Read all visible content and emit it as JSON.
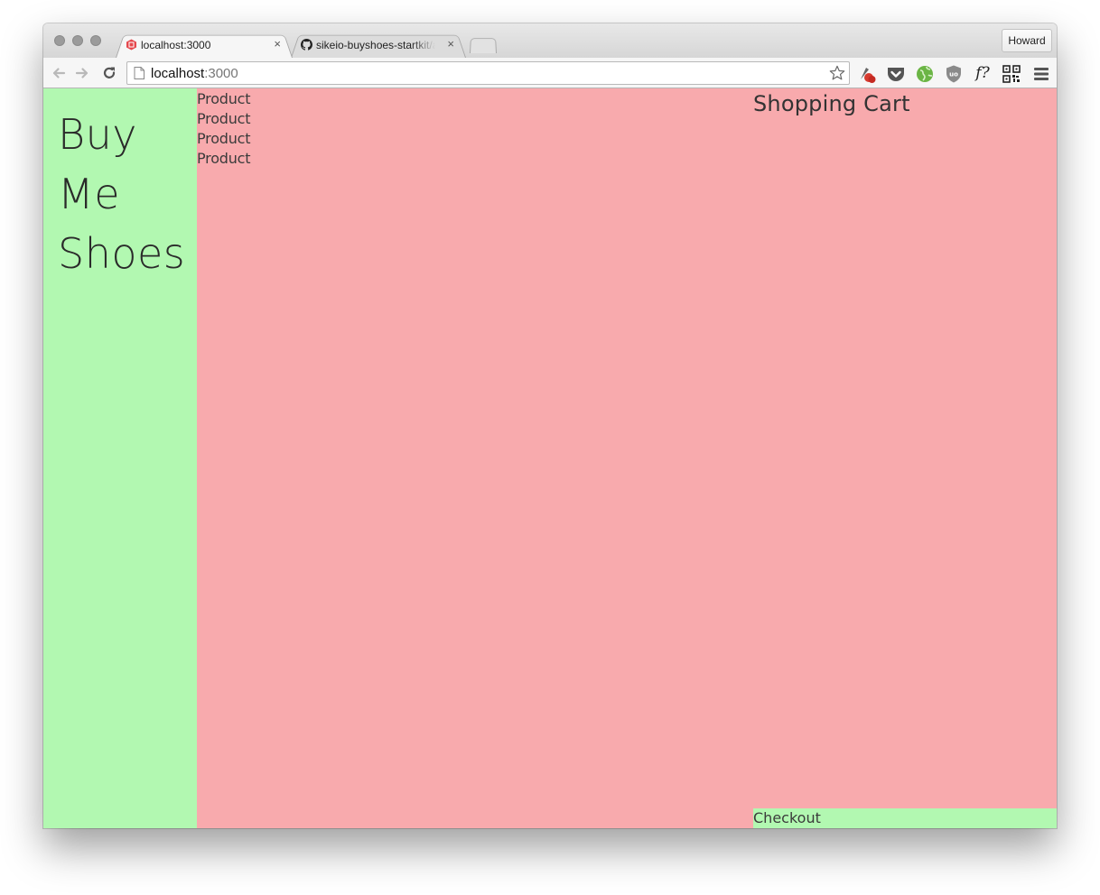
{
  "browser": {
    "tabs": [
      {
        "title": "localhost:3000",
        "close": "×",
        "favicon": "localhost-favicon-icon"
      },
      {
        "title": "sikeio-buyshoes-startkit/app",
        "close": "×",
        "favicon": "github-favicon-icon"
      }
    ],
    "profile": "Howard",
    "url": {
      "host": "localhost",
      "port": ":3000"
    },
    "extensions": [
      "cherry-extension-icon",
      "pocket-extension-icon",
      "globe-extension-icon",
      "ublock-extension-icon",
      "font-finder-extension-icon",
      "qr-code-extension-icon"
    ],
    "font_ext_label": "f?"
  },
  "app": {
    "title_lines": [
      "Buy",
      "Me",
      "Shoes"
    ],
    "products": [
      "Product",
      "Product",
      "Product",
      "Product"
    ],
    "cart_title": "Shopping Cart",
    "checkout_label": "Checkout"
  },
  "colors": {
    "sidebar": "#b2f8b1",
    "main": "#f8aaad",
    "checkout": "#b2f8b1"
  }
}
